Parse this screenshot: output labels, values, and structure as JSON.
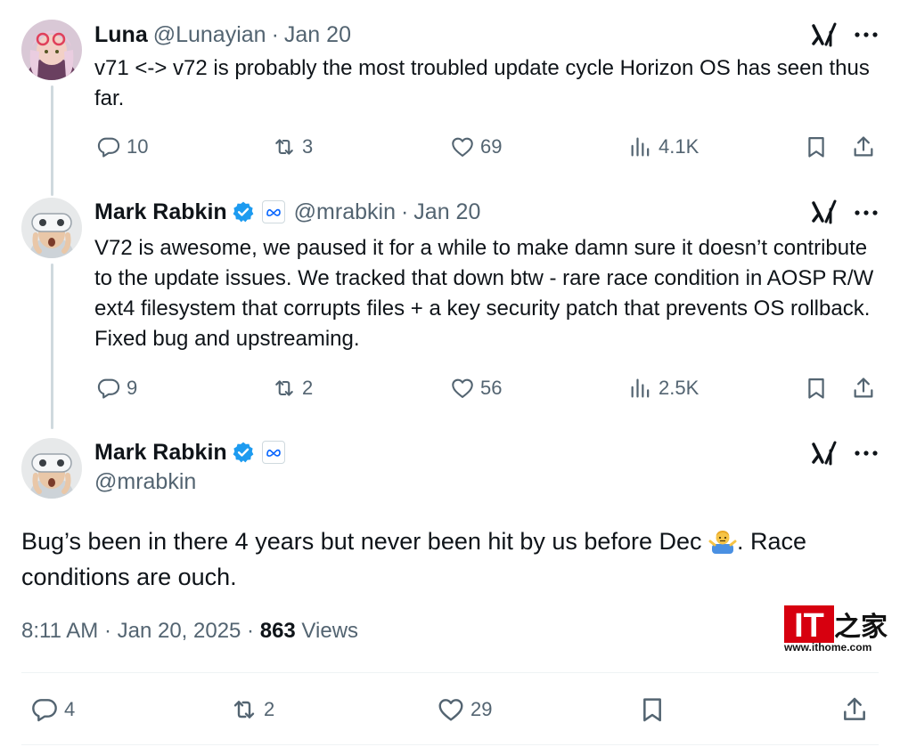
{
  "colors": {
    "accent": "#1d9bf0",
    "muted": "#536471",
    "text": "#0f1419",
    "line": "#cfd9de",
    "ithome_red": "#d7000f"
  },
  "tweets": [
    {
      "name": "Luna",
      "handle": "@Lunayian",
      "separator": "·",
      "date": "Jan 20",
      "text": "v71 <-> v72 is probably the most troubled update cycle Horizon OS has seen thus far.",
      "replies": "10",
      "retweets": "3",
      "likes": "69",
      "views": "4.1K"
    },
    {
      "name": "Mark Rabkin",
      "handle": "@mrabkin",
      "separator": "·",
      "date": "Jan 20",
      "text": "V72 is awesome, we paused it for a while to make damn sure it doesn’t contribute to the update issues. We tracked that down btw - rare race condition in AOSP R/W ext4 filesystem that corrupts files + a key security patch that prevents OS rollback. Fixed bug and upstreaming.",
      "replies": "9",
      "retweets": "2",
      "likes": "56",
      "views": "2.5K"
    }
  ],
  "main_tweet": {
    "name": "Mark Rabkin",
    "handle": "@mrabkin",
    "text_before": "Bug’s been in there 4 years but never been hit by us before Dec ",
    "text_after": ". Race conditions are ouch.",
    "time": "8:11 AM · Jan 20, 2025 · ",
    "views_count": "863",
    "views_label": " Views",
    "replies": "4",
    "retweets": "2",
    "likes": "29"
  },
  "watermark": {
    "logo": "IT之家",
    "url": "www.ithome.com"
  }
}
